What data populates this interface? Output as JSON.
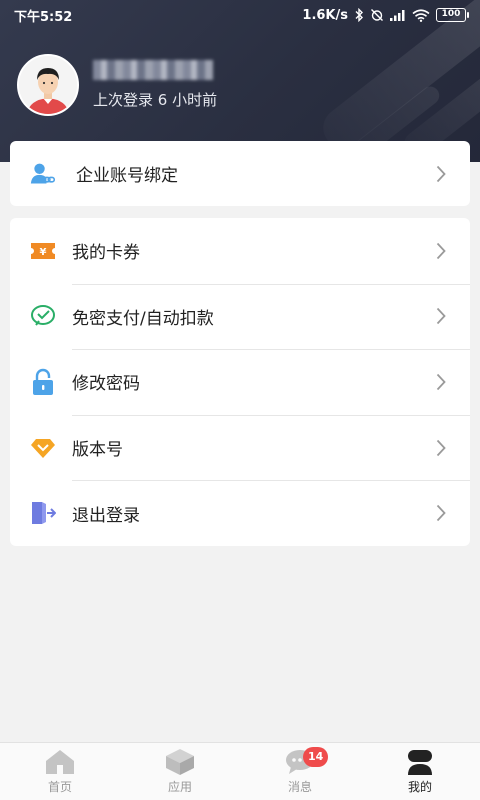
{
  "status_bar": {
    "time": "下午5:52",
    "network_speed": "1.6K/s",
    "battery": "100"
  },
  "profile": {
    "last_login": "上次登录 6 小时前"
  },
  "card_enterprise": {
    "label": "企业账号绑定",
    "icon": "enterprise-user-link-icon"
  },
  "menu": {
    "items": [
      {
        "label": "我的卡券",
        "icon": "coupon-icon"
      },
      {
        "label": "免密支付/自动扣款",
        "icon": "wechat-pay-icon"
      },
      {
        "label": "修改密码",
        "icon": "lock-icon"
      },
      {
        "label": "版本号",
        "icon": "version-diamond-icon"
      },
      {
        "label": "退出登录",
        "icon": "logout-door-icon"
      }
    ]
  },
  "tabbar": {
    "home": "首页",
    "apps": "应用",
    "messages": "消息",
    "messages_badge": "14",
    "mine": "我的"
  },
  "colors": {
    "header_bg": "#2a2f41",
    "coupon": "#f08a24",
    "wechat": "#2aae67",
    "lock": "#4da3e8",
    "version": "#f5a524",
    "logout": "#6e7be0",
    "badge": "#ef4b4b"
  }
}
